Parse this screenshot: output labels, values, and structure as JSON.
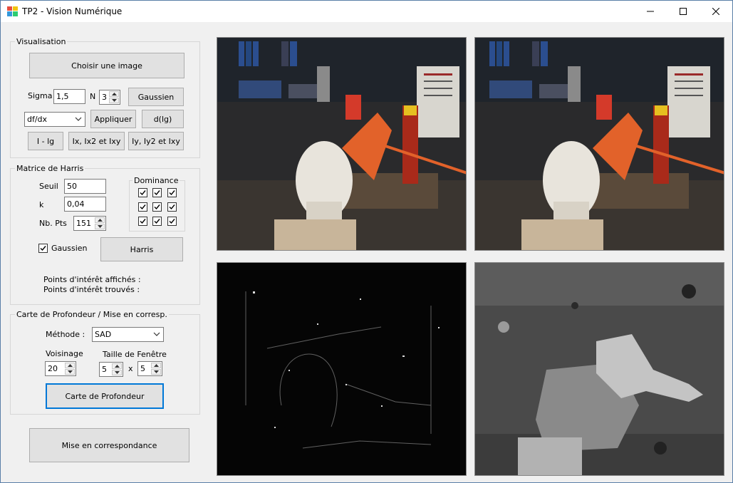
{
  "window": {
    "title": "TP2 - Vision Numérique",
    "controls": {
      "minimize": "–",
      "maximize": "☐",
      "close": "✕"
    }
  },
  "visualisation": {
    "legend": "Visualisation",
    "choose_image": "Choisir une image",
    "sigma_label": "Sigma",
    "sigma_value": "1,5",
    "n_label": "N",
    "n_value": "3",
    "gaussien_button": "Gaussien",
    "derivative_select": "df/dx",
    "appliquer_button": "Appliquer",
    "dlg_button": "d(lg)",
    "i_lg_button": "I - lg",
    "ix_button": "Ix, Ix2 et  Ixy",
    "iy_button": "Iy, Iy2 et Ixy"
  },
  "harris": {
    "legend": "Matrice de Harris",
    "seuil_label": "Seuil",
    "seuil_value": "50",
    "k_label": "k",
    "k_value": "0,04",
    "nbpts_label": "Nb. Pts",
    "nbpts_value": "151",
    "dominance_legend": "Dominance",
    "dominance_checked": [
      true,
      true,
      true,
      true,
      true,
      true,
      true,
      true,
      true
    ],
    "gaussien_checkbox_label": "Gaussien",
    "gaussien_checked": true,
    "harris_button": "Harris",
    "points_affiches": "Points d'intérêt affichés :",
    "points_trouves": "Points d'intérêt trouvés :"
  },
  "profondeur": {
    "legend": "Carte de Profondeur / Mise en corresp.",
    "methode_label": "Méthode :",
    "methode_value": "SAD",
    "voisinage_label": "Voisinage",
    "voisinage_value": "20",
    "taille_label": "Taille de Fenêtre",
    "taille_w": "5",
    "taille_x": "x",
    "taille_h": "5",
    "carte_button": "Carte de Profondeur"
  },
  "mise_button": "Mise en correspondance",
  "images": {
    "top_left": "stereo-left-image",
    "top_right": "stereo-right-image",
    "bottom_left": "gradient-edges-image",
    "bottom_right": "depth-map-image"
  },
  "colors": {
    "accent": "#0078d7",
    "button_bg": "#e1e1e1",
    "form_bg": "#f0f0f0"
  }
}
